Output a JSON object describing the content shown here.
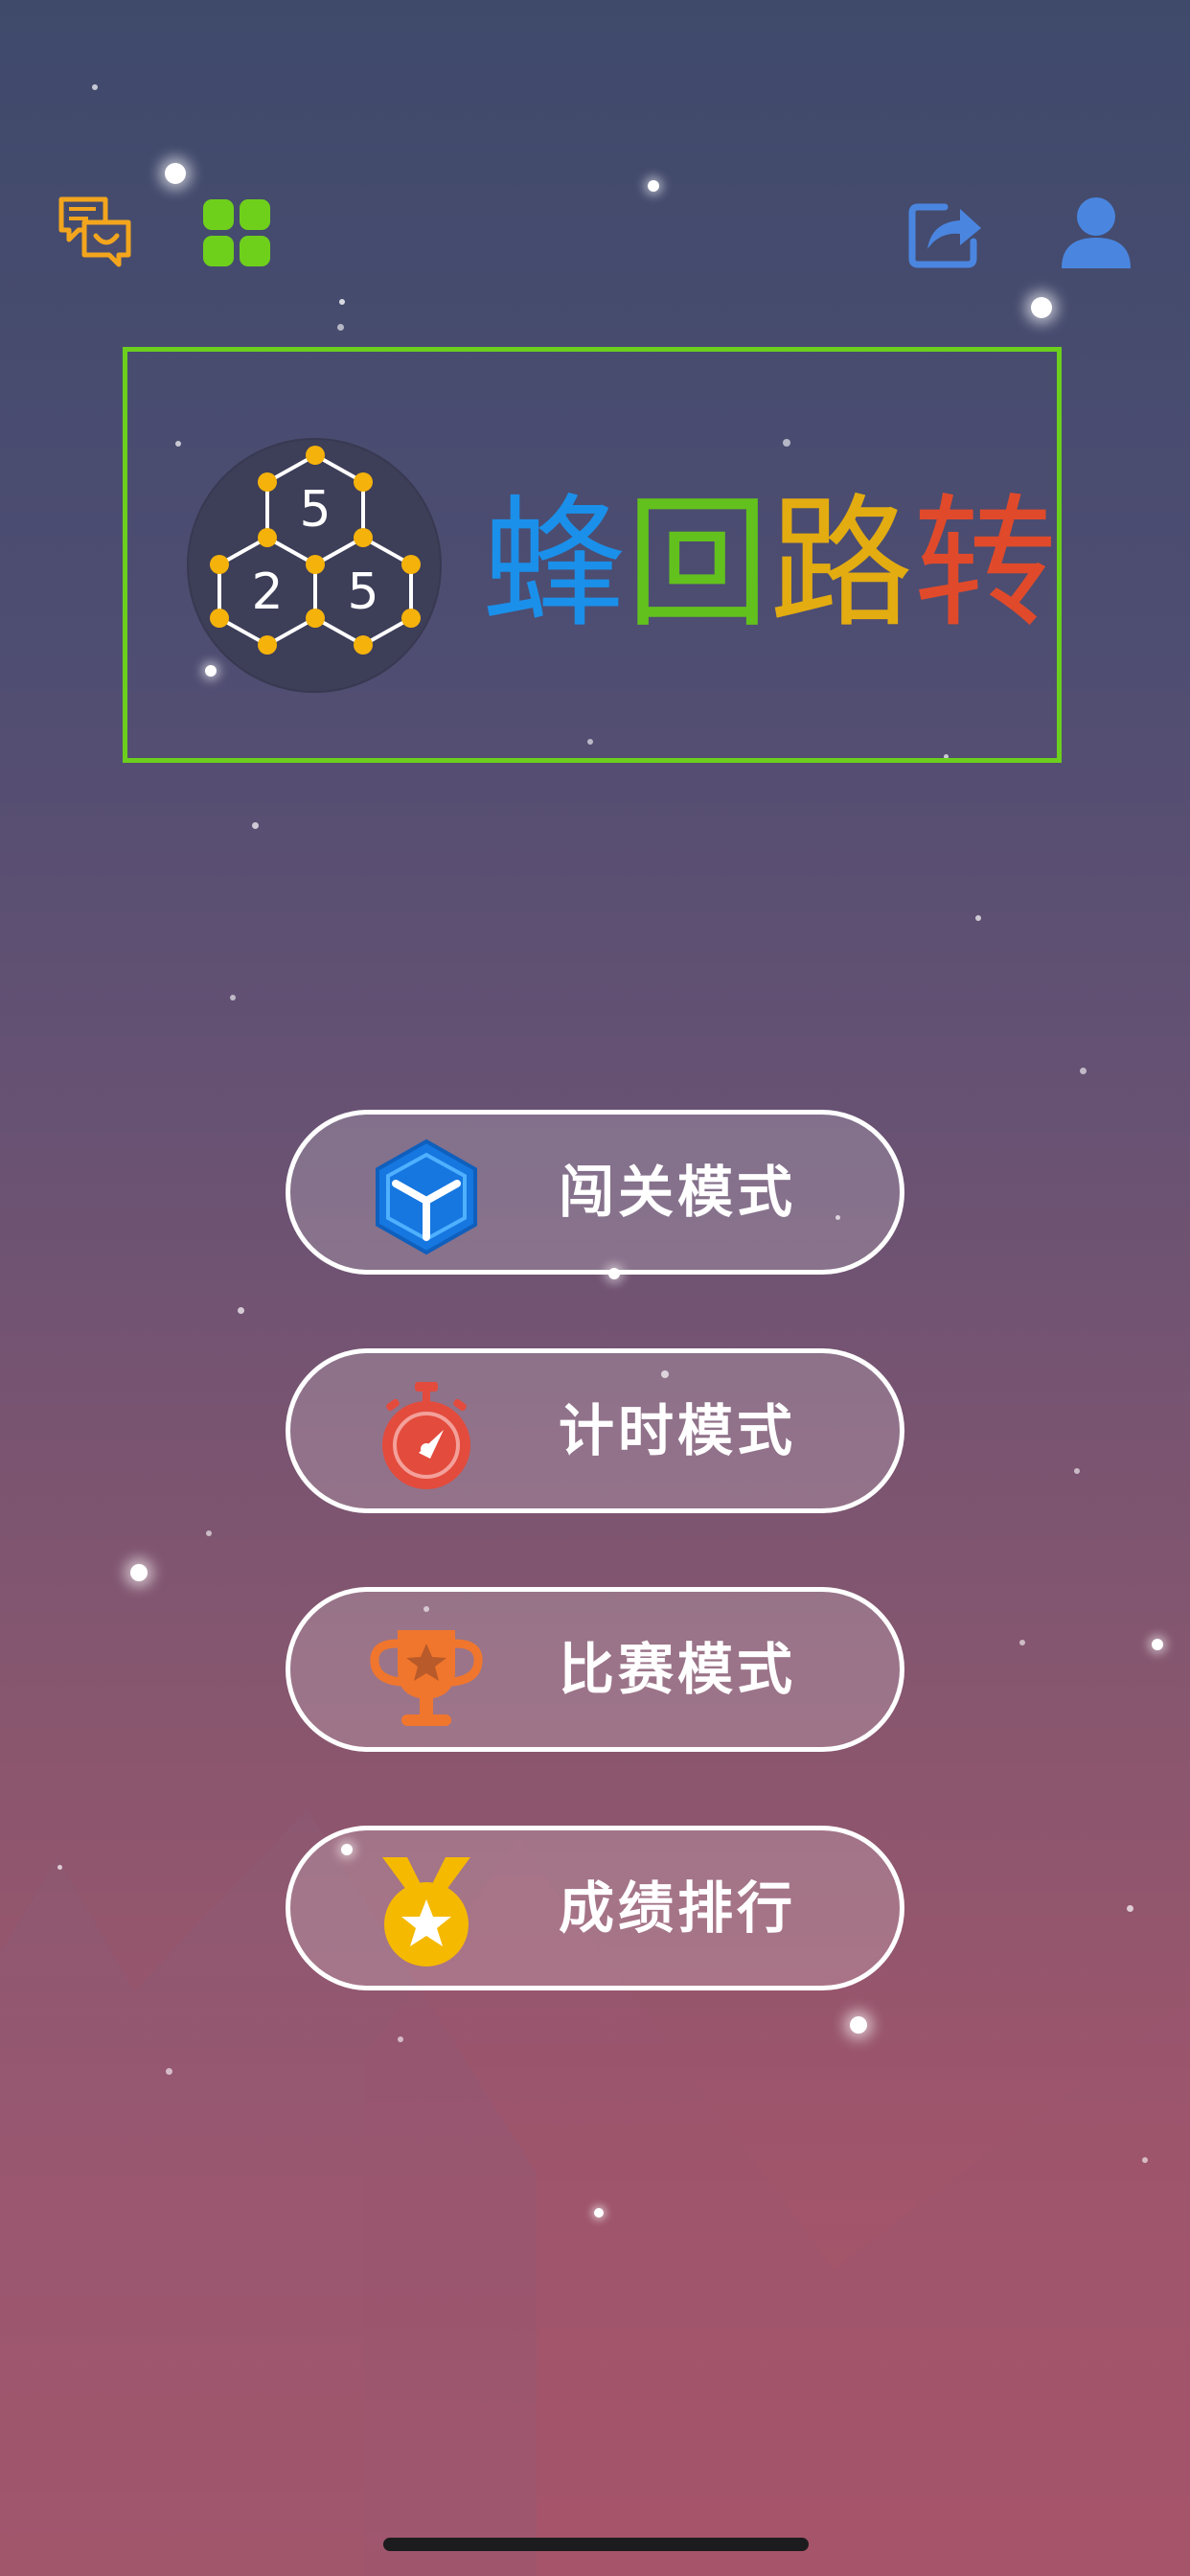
{
  "header": {
    "left_icons": [
      "chat-bubbles-icon",
      "grid-menu-icon"
    ],
    "right_icons": [
      "share-icon",
      "user-profile-icon"
    ]
  },
  "title_card": {
    "logo_numbers": [
      "5",
      "2",
      "5"
    ],
    "title_chars": [
      "蜂",
      "回",
      "路",
      "转"
    ],
    "title_colors": [
      "#1a90ea",
      "#63c11d",
      "#e3ac10",
      "#e04a2a"
    ],
    "border_color": "#6ccf1d"
  },
  "menu": {
    "buttons": [
      {
        "label": "闯关模式",
        "icon": "cube-icon",
        "icon_color": "#1677e0"
      },
      {
        "label": "计时模式",
        "icon": "stopwatch-icon",
        "icon_color": "#e34b3d"
      },
      {
        "label": "比赛模式",
        "icon": "trophy-icon",
        "icon_color": "#f0762d"
      },
      {
        "label": "成绩排行",
        "icon": "medal-icon",
        "icon_color": "#f5b900"
      }
    ]
  }
}
